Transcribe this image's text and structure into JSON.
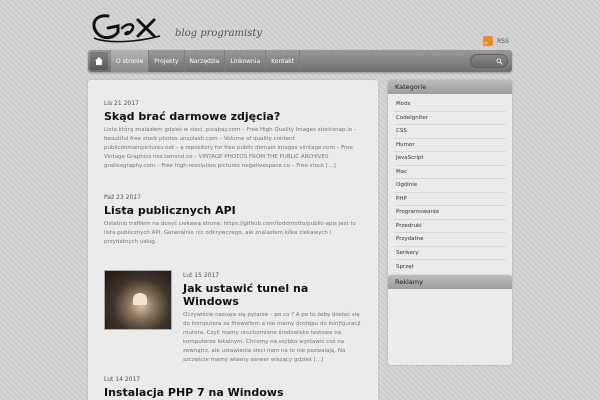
{
  "header": {
    "logo_text": "GeX",
    "tagline": "blog programisty",
    "rss_label": "RSS"
  },
  "nav": {
    "items": [
      {
        "label": "O stronie",
        "active": true
      },
      {
        "label": "Projekty",
        "active": false
      },
      {
        "label": "Narzędzia",
        "active": false
      },
      {
        "label": "Linkownia",
        "active": false
      },
      {
        "label": "Kontakt",
        "active": false
      }
    ]
  },
  "posts": [
    {
      "date": "Lis 21 2017",
      "title": "Skąd brać darmowe zdjęcia?",
      "excerpt": "Lista którą znalazłem gdzieś w sieci. pixabay.com – Free High Quality Images stocksnap.io – beautiful free stock photos unsplash.com – Volume of quality content publicdomainpictures.net – a repository for free public domain images viintage.com – Free Vintage Graphics nos.twnsnd.co – VINTAGE PHOTOS FROM THE PUBLIC ARCHIVES gratisography.com – Free high-resolution pictures negativespace.co – Free stock […]"
    },
    {
      "date": "Paź 23 2017",
      "title": "Lista publicznych API",
      "excerpt": "Ostatnio trafiłem na dosyć ciekawą stronę: https://github.com/toddmotto/public-apis jest to lista publicznych API. Generalnie nic odkrywczego, ale znalazłem kilka ciekawych i przydatnych usług."
    },
    {
      "date": "Lut 15 2017",
      "title": "Jak ustawić tunel na Windows",
      "excerpt": "Oczywiście nasuwa się pytanie – po co ? A po to żeby dostać się do komputera za firewallem a nie mamy dostępu do konfiguracji routera. Czyli mamy uruchomione środowisko testowe na komputerze lokalnym. Chcemy na szybko wystawić coś na zewnątrz, ale ustawienia sieci nam na to nie pozwalają. Na szczęście mamy własny serwer wiszący gdzieś […]"
    },
    {
      "date": "Lut 14 2017",
      "title": "Instalacja PHP 7 na Windows",
      "excerpt": ""
    }
  ],
  "sidebar": {
    "categories_title": "Kategorie",
    "categories": [
      "Mods",
      "CodeIgniter",
      "CSS",
      "Humor",
      "JavaScript",
      "Mac",
      "Ogólnie",
      "PHP",
      "Programowanie",
      "Przedruki",
      "Przydatne",
      "Serwery",
      "Sprzęt"
    ],
    "ads_title": "Reklamy"
  }
}
